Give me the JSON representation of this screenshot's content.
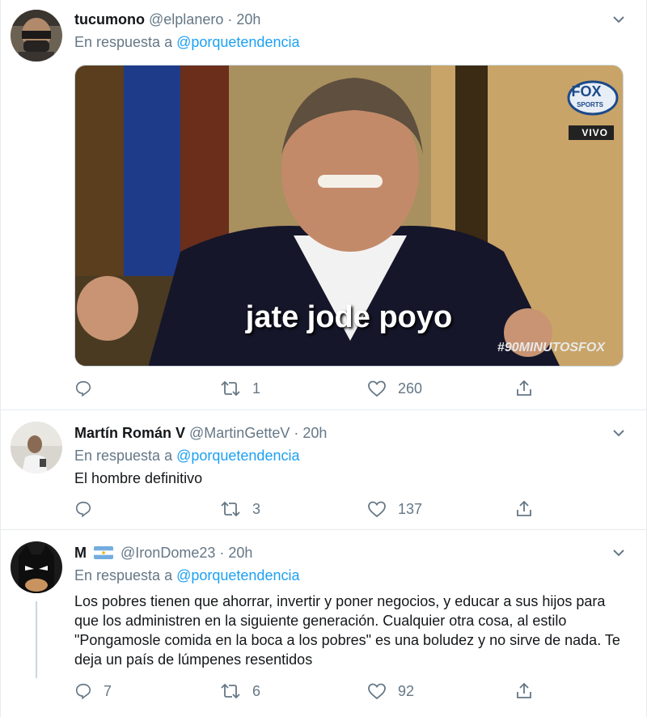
{
  "tweets": [
    {
      "name": "tucumono",
      "flag": "",
      "handle": "@elplanero",
      "time": "20h",
      "reply_prefix": "En respuesta a",
      "reply_to": "@porquetendencia",
      "text": "",
      "media_caption": "jate jode poyo",
      "media_logo": "FOX",
      "media_logo_sub": "SPORTS",
      "media_live": "VIVO",
      "media_hashtag": "#90MINUTOSFOX",
      "replies": "",
      "retweets": "1",
      "likes": "260"
    },
    {
      "name": "Martín Román V",
      "flag": "",
      "handle": "@MartinGetteV",
      "time": "20h",
      "reply_prefix": "En respuesta a",
      "reply_to": "@porquetendencia",
      "text": "El hombre definitivo",
      "replies": "",
      "retweets": "3",
      "likes": "137"
    },
    {
      "name": "M",
      "flag": "argentina-flag",
      "handle": "@IronDome23",
      "time": "20h",
      "reply_prefix": "En respuesta a",
      "reply_to": "@porquetendencia",
      "text": "Los pobres tienen que ahorrar, invertir y poner negocios, y educar a sus hijos para que los administren en la siguiente generación. Cualquier otra cosa, al estilo \"Pongamosle comida en la boca a los pobres\" es una boludez y no sirve de nada. Te deja un país de lúmpenes resentidos",
      "replies": "7",
      "retweets": "6",
      "likes": "92"
    }
  ],
  "separator": "·",
  "icons": {
    "reply": "reply-icon",
    "retweet": "retweet-icon",
    "like": "heart-icon",
    "share": "share-icon",
    "more": "chevron-down-icon"
  },
  "colors": {
    "link": "#1da1f2",
    "muted": "#657786",
    "text": "#14171a",
    "border": "#e6ecf0"
  }
}
